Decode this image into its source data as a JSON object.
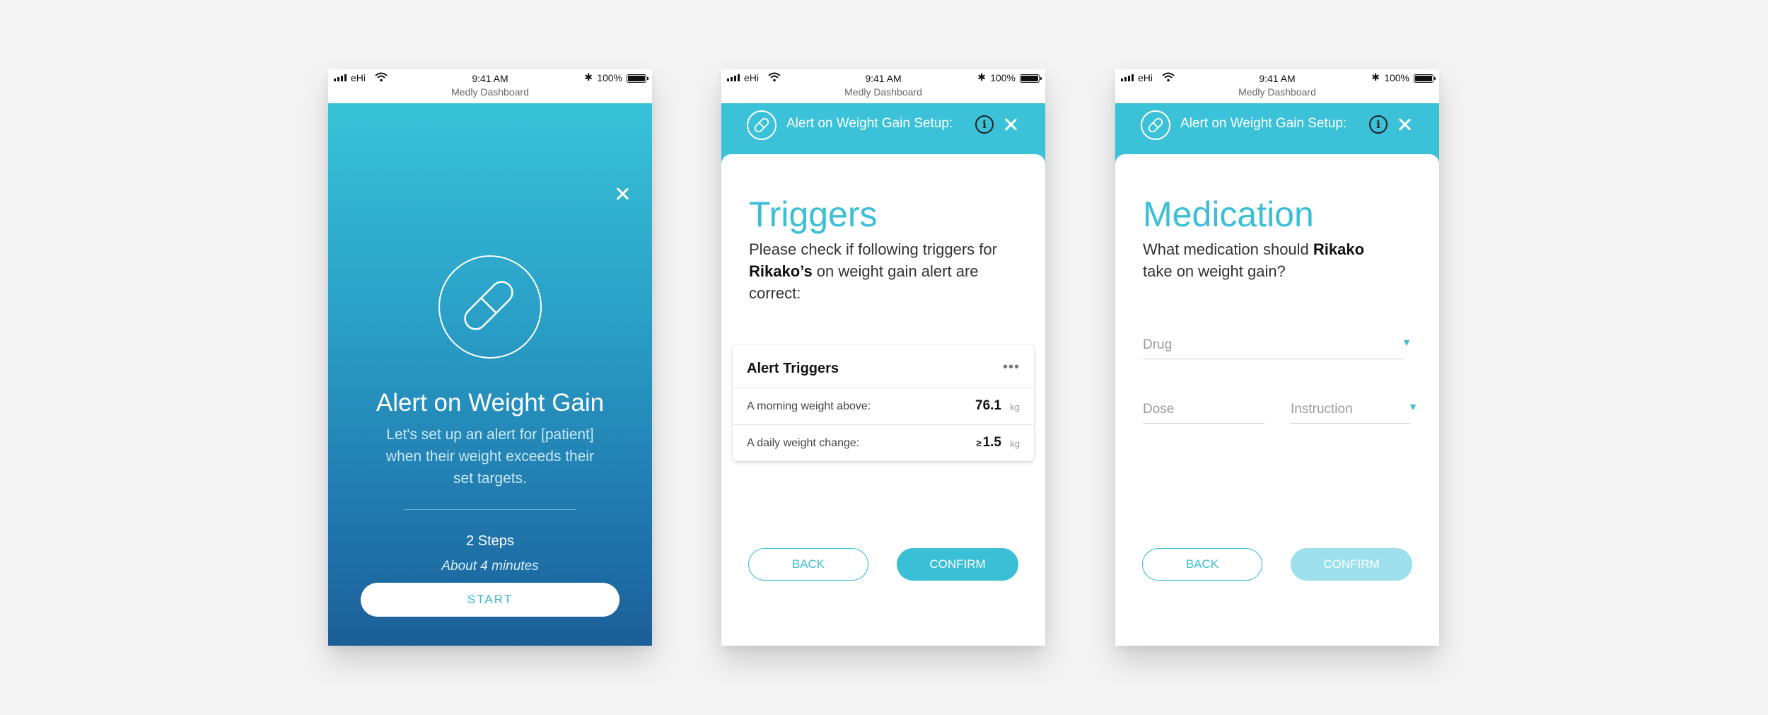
{
  "status_bar": {
    "carrier": "eHi",
    "time": "9:41 AM",
    "battery": "100%",
    "bluetooth_icon": "bluetooth-icon",
    "wifi_icon": "wifi-icon"
  },
  "app_name": "Medly Dashboard",
  "intro": {
    "title": "Alert on Weight Gain",
    "description": "Let's set up an alert for [patient] when their weight exceeds their set targets.",
    "steps": "2 Steps",
    "duration": "About 4 minutes",
    "start_label": "START",
    "icon": "pill-icon"
  },
  "setup_header": {
    "title": "Alert on Weight Gain Setup:",
    "info_label": "i"
  },
  "triggers": {
    "heading": "Triggers",
    "text_pre": "Please check if following triggers for ",
    "patient": "Rikako’s",
    "text_post": " on weight gain alert are correct:",
    "box_title": "Alert Triggers",
    "menu_label": "•••",
    "rows": [
      {
        "label": "A morning weight above:",
        "prefix": "",
        "value": "76.1",
        "unit": "kg"
      },
      {
        "label": "A daily weight change:",
        "prefix": "≥",
        "value": "1.5",
        "unit": "kg"
      }
    ],
    "back_label": "BACK",
    "confirm_label": "CONFIRM"
  },
  "medication": {
    "heading": "Medication",
    "text_pre": "What medication should ",
    "patient": "Rikako",
    "text_post": " take on weight gain?",
    "drug_placeholder": "Drug",
    "dose_placeholder": "Dose",
    "instruction_placeholder": "Instruction",
    "back_label": "BACK",
    "confirm_label": "CONFIRM"
  },
  "colors": {
    "accent": "#3bbfd6",
    "gradient_top": "#38c3d8",
    "gradient_bottom": "#1c5e98",
    "confirm_disabled": "#9ddfea"
  }
}
